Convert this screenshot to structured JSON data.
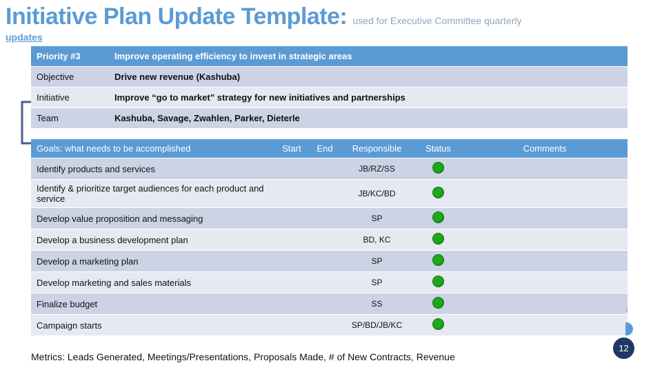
{
  "slide": {
    "title_main": "Initiative Plan Update Template:",
    "title_sub": "used for Executive Committee quarterly",
    "title_continuation": "updates",
    "page_number": "12",
    "accent_blue": "#5b9bd5",
    "row_dark": "#ccd3e5",
    "row_light": "#e6e9f2",
    "status_green": "#1fa81f",
    "badge_navy": "#1f3864"
  },
  "info_table": {
    "rows": [
      {
        "label": "Priority #3",
        "value": "Improve operating efficiency to invest in strategic areas"
      },
      {
        "label": "Objective",
        "value": "Drive new revenue  (Kashuba)"
      },
      {
        "label": "Initiative",
        "value": "Improve “go to market” strategy for new initiatives and partnerships"
      },
      {
        "label": "Team",
        "value": "Kashuba, Savage, Zwahlen, Parker, Dieterle"
      }
    ]
  },
  "goals_table": {
    "headers": {
      "goal": "Goals: what needs to be accomplished",
      "start": "Start",
      "end": "End",
      "responsible": "Responsible",
      "status": "Status",
      "comments": "Comments"
    },
    "rows": [
      {
        "goal": "Identify products and services",
        "start": "",
        "end": "",
        "responsible": "JB/RZ/SS",
        "status": "green",
        "comments": ""
      },
      {
        "goal": "Identify & prioritize target audiences for each product and service",
        "start": "",
        "end": "",
        "responsible": "JB/KC/BD",
        "status": "green",
        "comments": ""
      },
      {
        "goal": "Develop value proposition and messaging",
        "start": "",
        "end": "",
        "responsible": "SP",
        "status": "green",
        "comments": ""
      },
      {
        "goal": "Develop a business development plan",
        "start": "",
        "end": "",
        "responsible": "BD, KC",
        "status": "green",
        "comments": ""
      },
      {
        "goal": "Develop a marketing plan",
        "start": "",
        "end": "",
        "responsible": "SP",
        "status": "green",
        "comments": ""
      },
      {
        "goal": "Develop marketing and sales materials",
        "start": "",
        "end": "",
        "responsible": "SP",
        "status": "green",
        "comments": ""
      },
      {
        "goal": "Finalize budget",
        "start": "",
        "end": "",
        "responsible": "SS",
        "status": "green",
        "comments": ""
      },
      {
        "goal": "Campaign starts",
        "start": "",
        "end": "",
        "responsible": "SP/BD/JB/KC",
        "status": "green",
        "comments": ""
      }
    ]
  },
  "footer": {
    "metrics": "Metrics:  Leads Generated, Meetings/Presentations, Proposals Made, # of New Contracts, Revenue"
  }
}
